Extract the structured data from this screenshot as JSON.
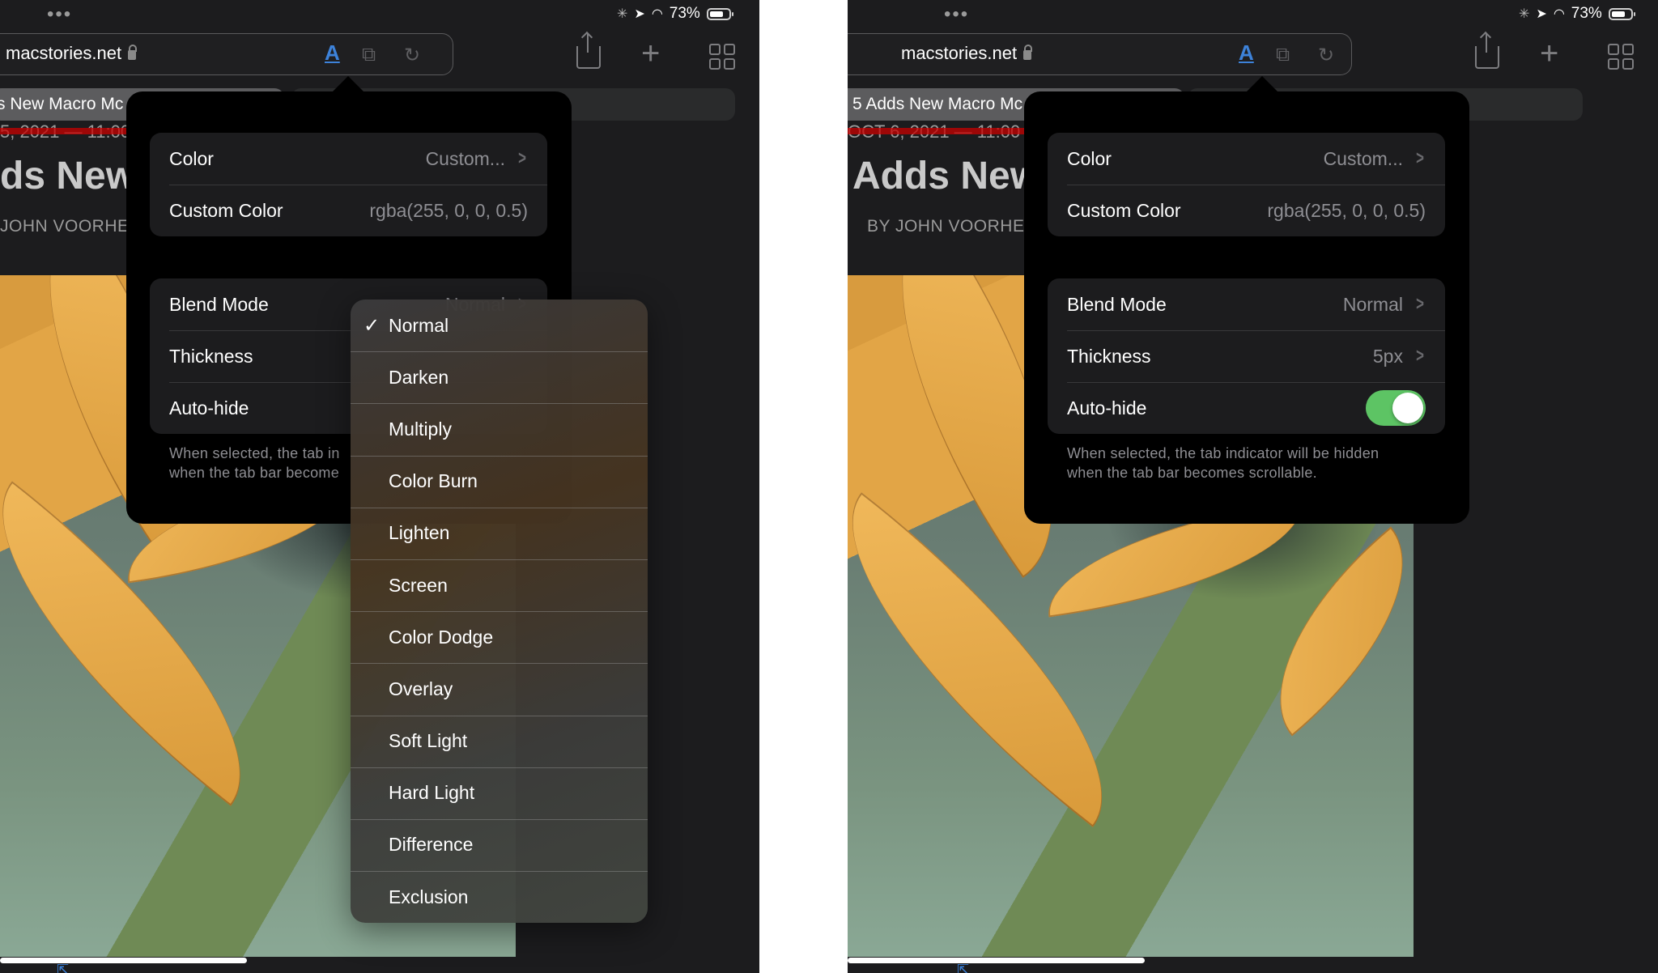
{
  "status_bar": {
    "more_indicator": "•••",
    "battery_percent": "73%",
    "battery_level": 0.73
  },
  "browser": {
    "url": "macstories.net",
    "reader_icon_label": "A",
    "tab_title_left": "s New Macro Mc",
    "tab_title_right": "5 Adds New Macro Mc"
  },
  "article": {
    "date_line_left": "5, 2021 — 11:00",
    "date_line_right": "OCT 6, 2021 — 11:00",
    "headline_left": "ds New",
    "headline_right": "Adds New",
    "byline_left": "JOHN VOORHE",
    "byline_right": "BY JOHN VOORHE"
  },
  "settings": {
    "color_label": "Color",
    "color_value": "Custom...",
    "custom_color_label": "Custom Color",
    "custom_color_value": "rgba(255, 0, 0, 0.5)",
    "blend_mode_label": "Blend Mode",
    "blend_mode_value": "Normal",
    "thickness_label": "Thickness",
    "thickness_value": "5px",
    "autohide_label": "Auto-hide",
    "autohide_on": true,
    "footer_line1": "When selected, the tab indicator will be hidden",
    "footer_line2": "when the tab bar becomes scrollable.",
    "footer_line1_clipped": "When selected, the tab in",
    "footer_line2_clipped": "when the tab bar become"
  },
  "blend_menu": {
    "selected": "Normal",
    "check_glyph": "✓",
    "items": [
      "Normal",
      "Darken",
      "Multiply",
      "Color Burn",
      "Lighten",
      "Screen",
      "Color Dodge",
      "Overlay",
      "Soft Light",
      "Hard Light",
      "Difference",
      "Exclusion"
    ]
  },
  "colors": {
    "accent_blue": "#3d82d9",
    "toggle_green": "#5dc464",
    "indicator_red": "rgba(255, 0, 0, 0.5)"
  }
}
